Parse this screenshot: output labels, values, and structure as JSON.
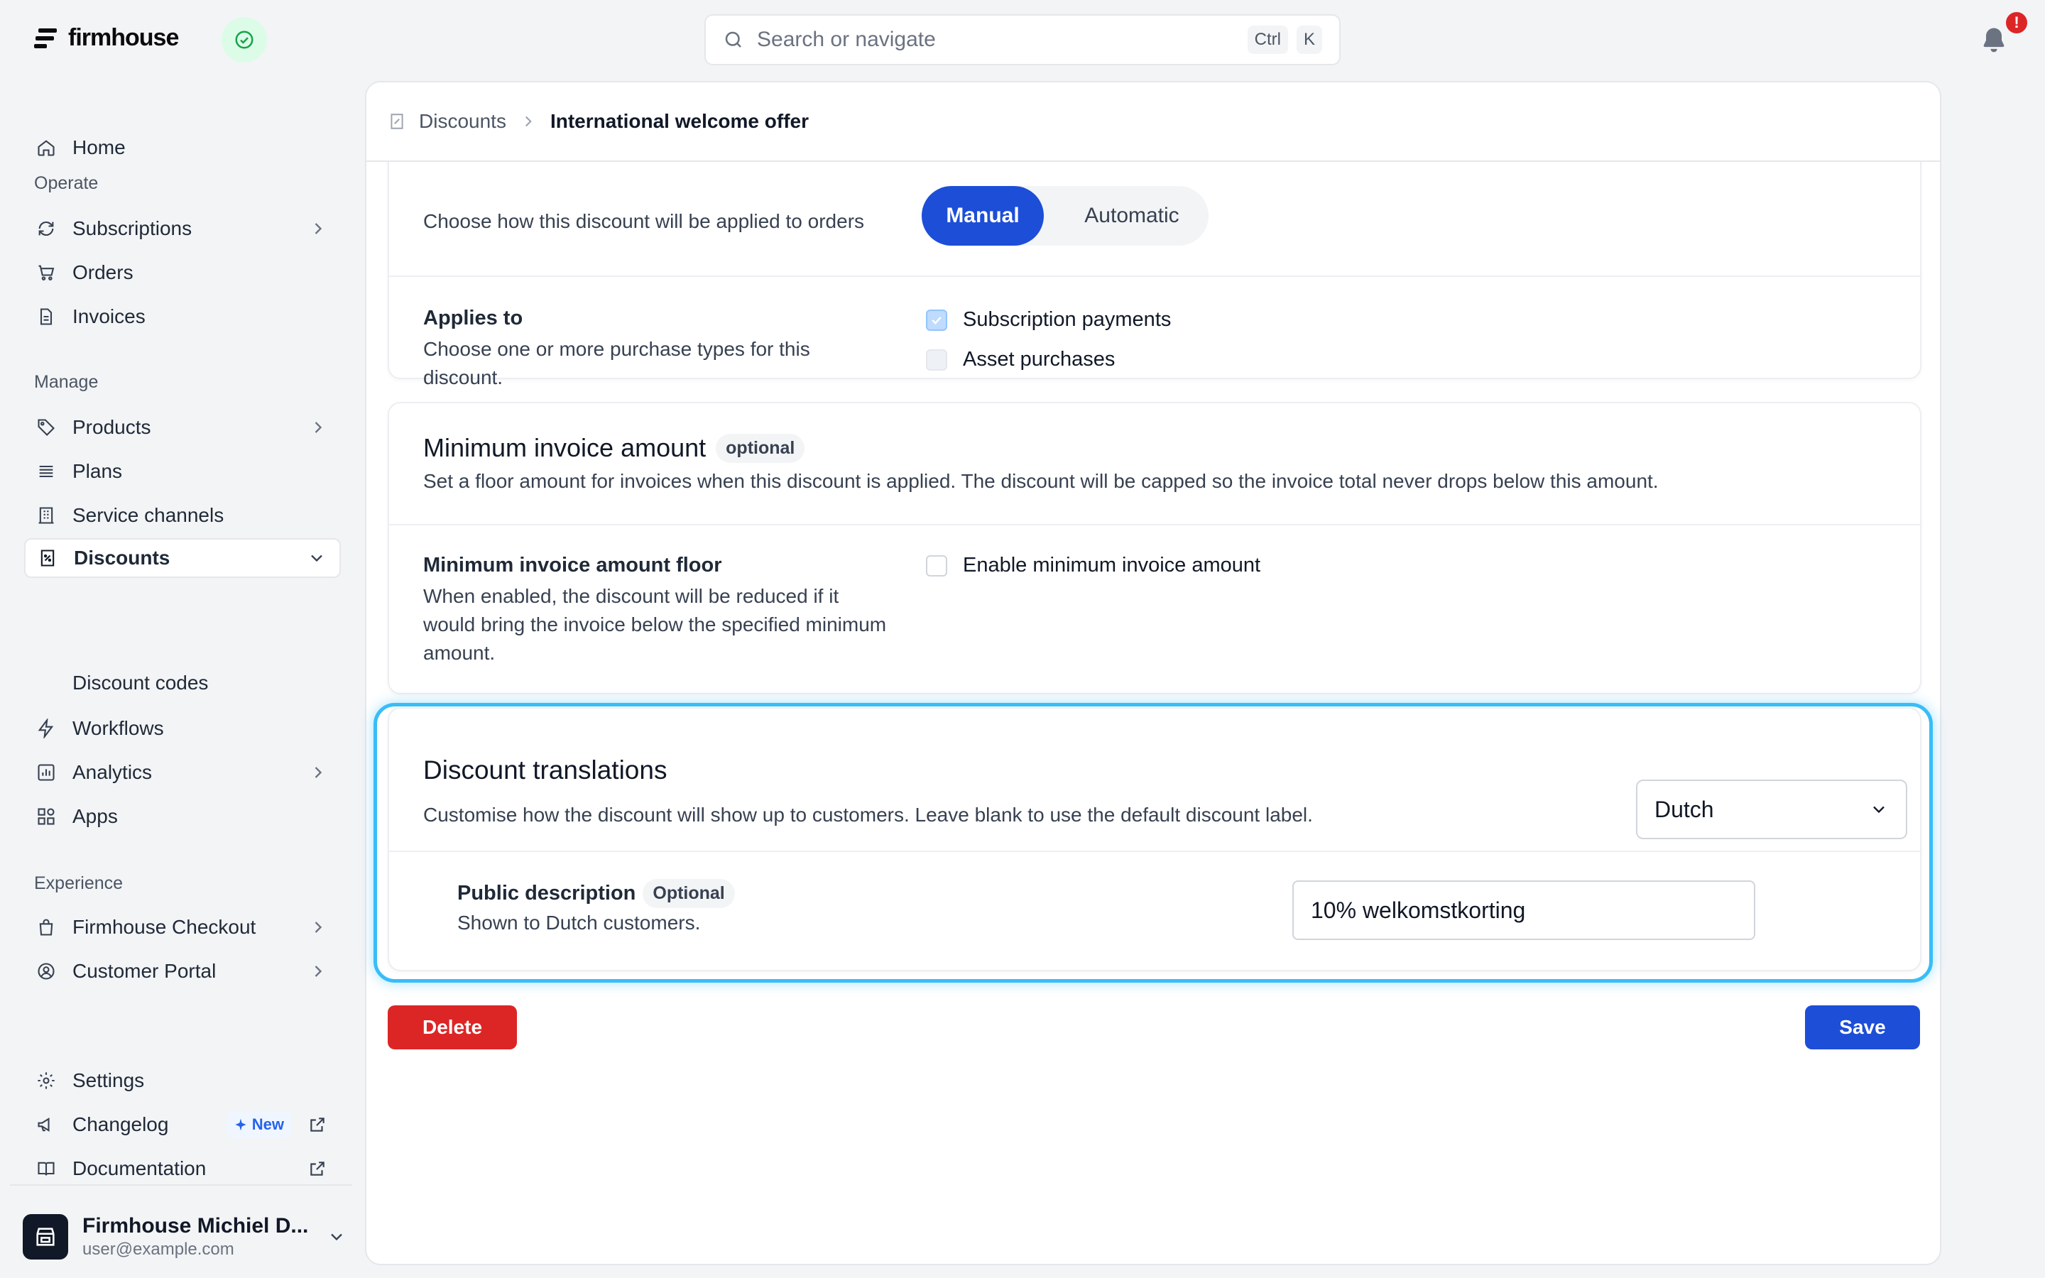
{
  "app": {
    "brand": "firmhouse"
  },
  "search": {
    "placeholder": "Search or navigate",
    "kbd_ctrl": "Ctrl",
    "kbd_k": "K"
  },
  "notifications": {
    "badge": "!"
  },
  "sidebar": {
    "home": "Home",
    "section_operate": "Operate",
    "subscriptions": "Subscriptions",
    "orders": "Orders",
    "invoices": "Invoices",
    "section_manage": "Manage",
    "products": "Products",
    "plans": "Plans",
    "service_channels": "Service channels",
    "discounts": "Discounts",
    "discount_codes": "Discount codes",
    "workflows": "Workflows",
    "analytics": "Analytics",
    "apps": "Apps",
    "section_experience": "Experience",
    "checkout": "Firmhouse Checkout",
    "customer_portal": "Customer Portal",
    "settings": "Settings",
    "changelog": "Changelog",
    "changelog_badge": "New",
    "documentation": "Documentation"
  },
  "account": {
    "name": "Firmhouse Michiel D...",
    "email": "user@example.com"
  },
  "breadcrumb": {
    "parent": "Discounts",
    "current": "International welcome offer"
  },
  "discount_type": {
    "description": "Choose how this discount will be applied to orders",
    "options": [
      "Manual",
      "Automatic"
    ],
    "selected": "Manual"
  },
  "applies_to": {
    "title": "Applies to",
    "description": "Choose one or more purchase types for this discount.",
    "options": [
      {
        "label": "Subscription payments",
        "checked": true
      },
      {
        "label": "Asset purchases",
        "checked": false
      }
    ]
  },
  "min_invoice": {
    "title": "Minimum invoice amount",
    "badge": "optional",
    "description": "Set a floor amount for invoices when this discount is applied. The discount will be capped so the invoice total never drops below this amount.",
    "floor_title": "Minimum invoice amount floor",
    "floor_description": "When enabled, the discount will be reduced if it would bring the invoice below the specified minimum amount.",
    "enable_label": "Enable minimum invoice amount",
    "enabled": false
  },
  "translations": {
    "title": "Discount translations",
    "description": "Customise how the discount will show up to customers. Leave blank to use the default discount label.",
    "language": "Dutch",
    "public_description_label": "Public description",
    "public_description_badge": "Optional",
    "public_description_help": "Shown to Dutch customers.",
    "public_description_value": "10% welkomstkorting"
  },
  "actions": {
    "delete": "Delete",
    "save": "Save"
  },
  "colors": {
    "primary": "#1d4ed8",
    "danger": "#dc2626",
    "highlight": "#38bdf8"
  }
}
